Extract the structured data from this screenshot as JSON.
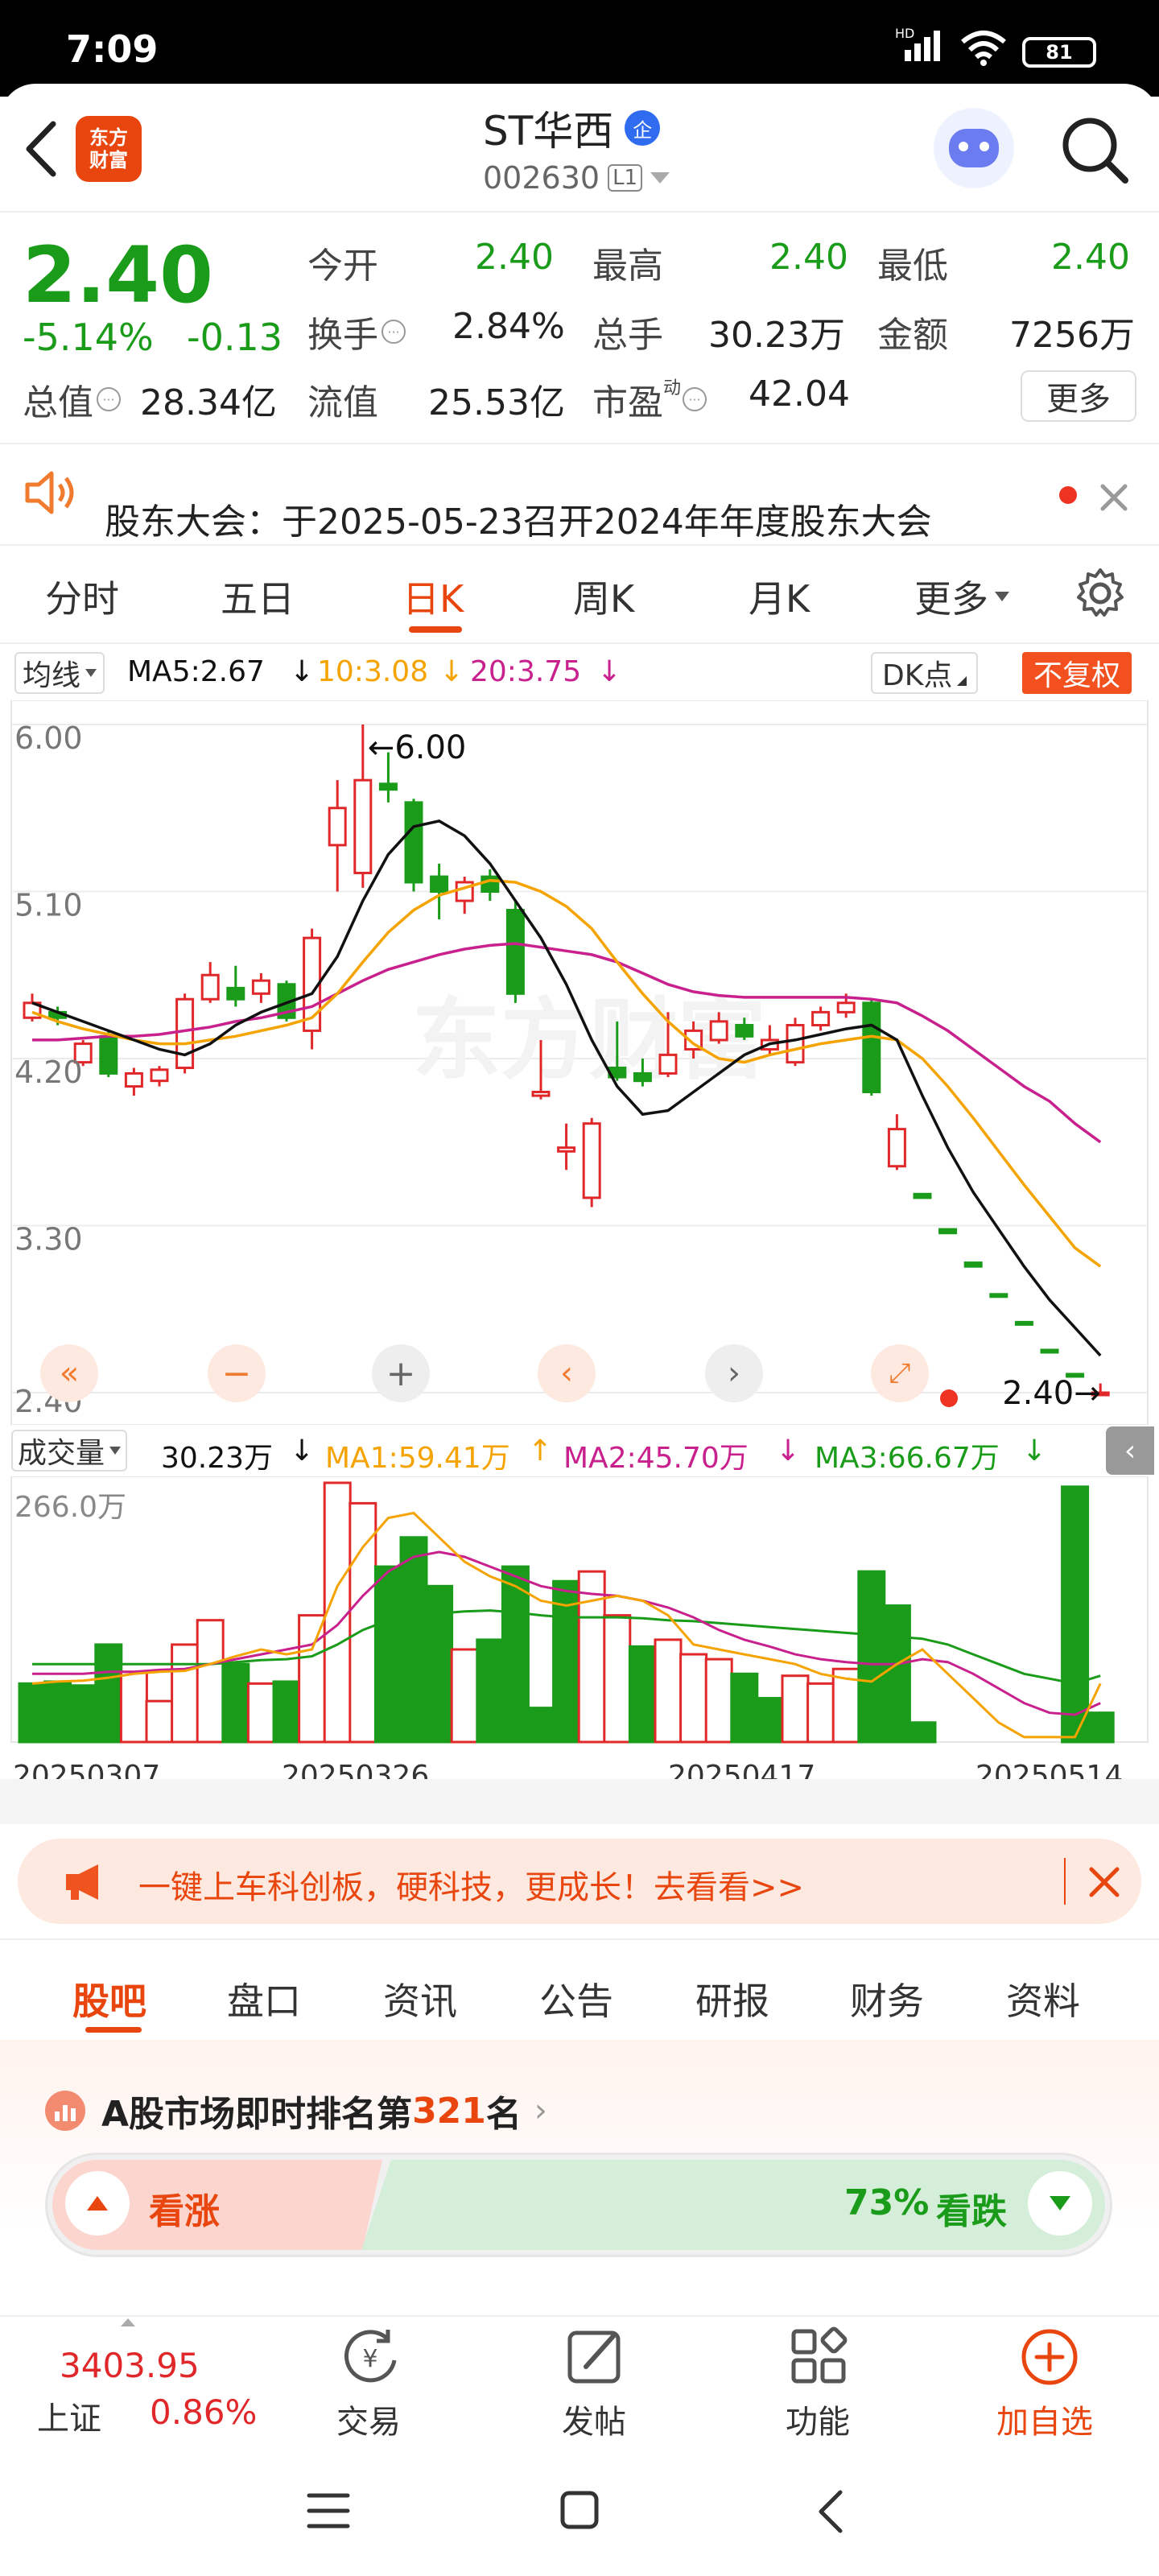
{
  "status_bar": {
    "time": "7:09",
    "net_tag": "HD",
    "battery": "81"
  },
  "header": {
    "app_logo_line1": "东方",
    "app_logo_line2": "财富",
    "stock_name": "ST华西",
    "badge": "企",
    "stock_code": "002630",
    "level_tag": "L1"
  },
  "quote": {
    "price": "2.40",
    "change_pct": "-5.14%",
    "change": "-0.13",
    "open_label": "今开",
    "open": "2.40",
    "high_label": "最高",
    "high": "2.40",
    "low_label": "最低",
    "low": "2.40",
    "turnover_label": "换手",
    "turnover": "2.84%",
    "volume_label": "总手",
    "volume": "30.23万",
    "amount_label": "金额",
    "amount": "7256万",
    "mktcap_label": "总值",
    "mktcap": "28.34亿",
    "float_label": "流值",
    "float": "25.53亿",
    "pe_label": "市盈",
    "pe_sup": "动",
    "pe": "42.04",
    "more_label": "更多"
  },
  "notice": {
    "text": "股东大会：于2025-05-23召开2024年年度股东大会"
  },
  "chart_tabs": [
    "分时",
    "五日",
    "日K",
    "周K",
    "月K",
    "更多"
  ],
  "kline_bar": {
    "ma_type": "均线",
    "ma5": "MA5:2.67",
    "ma10": "10:3.08",
    "ma20": "20:3.75",
    "dk_label": "DK点",
    "adjust_label": "不复权"
  },
  "kline_axis": {
    "labels": [
      "6.00",
      "5.10",
      "4.20",
      "3.30",
      "2.40"
    ],
    "max_note": "←6.00",
    "last_note": "2.40→"
  },
  "volume_bar": {
    "label": "成交量",
    "current": "30.23万",
    "ma1": "MA1:59.41万",
    "ma2": "MA2:45.70万",
    "ma3": "MA3:66.67万",
    "max_label": "266.0万"
  },
  "dates": [
    "20250307",
    "20250326",
    "20250417",
    "20250514"
  ],
  "colors": {
    "up": "#e0282a",
    "down": "#1a9c1a",
    "accent": "#ff6600",
    "ma5": "#111111",
    "ma10": "#f5a300",
    "ma20": "#c8208c"
  },
  "chart_data": {
    "type": "candlestick",
    "y_range": [
      2.4,
      6.0
    ],
    "candles": [
      {
        "o": 4.42,
        "c": 4.5,
        "h": 4.55,
        "l": 4.4
      },
      {
        "o": 4.45,
        "c": 4.42,
        "h": 4.48,
        "l": 4.38
      },
      {
        "o": 4.18,
        "c": 4.28,
        "h": 4.3,
        "l": 4.16
      },
      {
        "o": 4.32,
        "c": 4.12,
        "h": 4.35,
        "l": 4.1
      },
      {
        "o": 4.05,
        "c": 4.12,
        "h": 4.15,
        "l": 4.0
      },
      {
        "o": 4.08,
        "c": 4.14,
        "h": 4.16,
        "l": 4.05
      },
      {
        "o": 4.15,
        "c": 4.52,
        "h": 4.55,
        "l": 4.12
      },
      {
        "o": 4.52,
        "c": 4.65,
        "h": 4.72,
        "l": 4.5
      },
      {
        "o": 4.58,
        "c": 4.52,
        "h": 4.7,
        "l": 4.48
      },
      {
        "o": 4.55,
        "c": 4.62,
        "h": 4.66,
        "l": 4.5
      },
      {
        "o": 4.6,
        "c": 4.42,
        "h": 4.62,
        "l": 4.4
      },
      {
        "o": 4.35,
        "c": 4.85,
        "h": 4.9,
        "l": 4.25
      },
      {
        "o": 5.35,
        "c": 5.55,
        "h": 5.7,
        "l": 5.1
      },
      {
        "o": 5.2,
        "c": 5.7,
        "h": 6.0,
        "l": 5.12
      },
      {
        "o": 5.68,
        "c": 5.65,
        "h": 5.85,
        "l": 5.58
      },
      {
        "o": 5.58,
        "c": 5.15,
        "h": 5.6,
        "l": 5.1
      },
      {
        "o": 5.18,
        "c": 5.1,
        "h": 5.25,
        "l": 4.95
      },
      {
        "o": 5.05,
        "c": 5.15,
        "h": 5.18,
        "l": 4.98
      },
      {
        "o": 5.18,
        "c": 5.1,
        "h": 5.22,
        "l": 5.05
      },
      {
        "o": 5.0,
        "c": 4.55,
        "h": 5.05,
        "l": 4.5
      },
      {
        "o": 4.0,
        "c": 4.02,
        "h": 4.3,
        "l": 3.98
      },
      {
        "o": 3.7,
        "c": 3.72,
        "h": 3.85,
        "l": 3.6
      },
      {
        "o": 3.45,
        "c": 3.85,
        "h": 3.88,
        "l": 3.4
      },
      {
        "o": 4.15,
        "c": 4.1,
        "h": 4.4,
        "l": 4.08
      },
      {
        "o": 4.12,
        "c": 4.08,
        "h": 4.2,
        "l": 4.05
      },
      {
        "o": 4.12,
        "c": 4.22,
        "h": 4.45,
        "l": 4.1
      },
      {
        "o": 4.25,
        "c": 4.35,
        "h": 4.4,
        "l": 4.2
      },
      {
        "o": 4.3,
        "c": 4.4,
        "h": 4.45,
        "l": 4.28
      },
      {
        "o": 4.38,
        "c": 4.32,
        "h": 4.42,
        "l": 4.3
      },
      {
        "o": 4.25,
        "c": 4.3,
        "h": 4.38,
        "l": 4.22
      },
      {
        "o": 4.18,
        "c": 4.38,
        "h": 4.42,
        "l": 4.16
      },
      {
        "o": 4.38,
        "c": 4.45,
        "h": 4.48,
        "l": 4.35
      },
      {
        "o": 4.45,
        "c": 4.5,
        "h": 4.55,
        "l": 4.42
      },
      {
        "o": 4.5,
        "c": 4.02,
        "h": 4.52,
        "l": 4.0
      },
      {
        "o": 3.62,
        "c": 3.82,
        "h": 3.9,
        "l": 3.6
      },
      {
        "o": 3.47,
        "c": 3.45,
        "h": 3.47,
        "l": 3.45
      },
      {
        "o": 3.28,
        "c": 3.26,
        "h": 3.28,
        "l": 3.26
      },
      {
        "o": 3.1,
        "c": 3.08,
        "h": 3.1,
        "l": 3.08
      },
      {
        "o": 2.93,
        "c": 2.92,
        "h": 2.93,
        "l": 2.92
      },
      {
        "o": 2.78,
        "c": 2.77,
        "h": 2.78,
        "l": 2.77
      },
      {
        "o": 2.63,
        "c": 2.62,
        "h": 2.63,
        "l": 2.62
      },
      {
        "o": 2.5,
        "c": 2.49,
        "h": 2.5,
        "l": 2.49
      },
      {
        "o": 2.4,
        "c": 2.4,
        "h": 2.45,
        "l": 2.4
      }
    ],
    "ma5": [
      4.5,
      4.45,
      4.4,
      4.35,
      4.3,
      4.25,
      4.22,
      4.28,
      4.38,
      4.45,
      4.5,
      4.55,
      4.75,
      5.05,
      5.3,
      5.45,
      5.48,
      5.4,
      5.25,
      5.05,
      4.85,
      4.6,
      4.3,
      4.05,
      3.9,
      3.92,
      4.02,
      4.12,
      4.22,
      4.28,
      4.3,
      4.33,
      4.36,
      4.38,
      4.3,
      4.0,
      3.72,
      3.48,
      3.28,
      3.08,
      2.9,
      2.75,
      2.6
    ],
    "ma10": [
      4.45,
      4.4,
      4.36,
      4.33,
      4.3,
      4.28,
      4.28,
      4.3,
      4.32,
      4.35,
      4.38,
      4.42,
      4.55,
      4.72,
      4.88,
      5.0,
      5.08,
      5.12,
      5.16,
      5.15,
      5.1,
      5.02,
      4.9,
      4.72,
      4.55,
      4.4,
      4.28,
      4.2,
      4.18,
      4.22,
      4.25,
      4.28,
      4.3,
      4.32,
      4.3,
      4.2,
      4.05,
      3.88,
      3.7,
      3.52,
      3.35,
      3.18,
      3.08
    ],
    "ma20": [
      4.3,
      4.3,
      4.31,
      4.32,
      4.32,
      4.33,
      4.35,
      4.37,
      4.4,
      4.42,
      4.45,
      4.48,
      4.55,
      4.62,
      4.68,
      4.72,
      4.76,
      4.79,
      4.81,
      4.82,
      4.8,
      4.78,
      4.76,
      4.72,
      4.66,
      4.6,
      4.56,
      4.54,
      4.53,
      4.53,
      4.53,
      4.53,
      4.53,
      4.52,
      4.5,
      4.43,
      4.35,
      4.25,
      4.15,
      4.05,
      3.97,
      3.85,
      3.75
    ],
    "volume": [
      {
        "v": 60,
        "up": false
      },
      {
        "v": 62,
        "up": false
      },
      {
        "v": 58,
        "up": false
      },
      {
        "v": 100,
        "up": false
      },
      {
        "v": 72,
        "up": true
      },
      {
        "v": 42,
        "up": true
      },
      {
        "v": 100,
        "up": true
      },
      {
        "v": 125,
        "up": true
      },
      {
        "v": 80,
        "up": false
      },
      {
        "v": 60,
        "up": true
      },
      {
        "v": 62,
        "up": false
      },
      {
        "v": 130,
        "up": true
      },
      {
        "v": 266,
        "up": true
      },
      {
        "v": 245,
        "up": true
      },
      {
        "v": 180,
        "up": false
      },
      {
        "v": 210,
        "up": false
      },
      {
        "v": 160,
        "up": false
      },
      {
        "v": 95,
        "up": true
      },
      {
        "v": 105,
        "up": false
      },
      {
        "v": 180,
        "up": false
      },
      {
        "v": 35,
        "up": false
      },
      {
        "v": 165,
        "up": false
      },
      {
        "v": 175,
        "up": true
      },
      {
        "v": 130,
        "up": true
      },
      {
        "v": 98,
        "up": false
      },
      {
        "v": 105,
        "up": true
      },
      {
        "v": 90,
        "up": true
      },
      {
        "v": 85,
        "up": true
      },
      {
        "v": 70,
        "up": false
      },
      {
        "v": 45,
        "up": false
      },
      {
        "v": 68,
        "up": true
      },
      {
        "v": 60,
        "up": true
      },
      {
        "v": 75,
        "up": true
      },
      {
        "v": 175,
        "up": false
      },
      {
        "v": 140,
        "up": false
      },
      {
        "v": 20,
        "up": false
      },
      {
        "v": 0,
        "up": false
      },
      {
        "v": 0,
        "up": false
      },
      {
        "v": 0,
        "up": false
      },
      {
        "v": 0,
        "up": false
      },
      {
        "v": 0,
        "up": false
      },
      {
        "v": 262,
        "up": false
      },
      {
        "v": 30,
        "up": false
      }
    ],
    "vol_ma1": [
      60,
      62,
      63,
      66,
      70,
      72,
      73,
      80,
      88,
      95,
      90,
      95,
      160,
      200,
      230,
      235,
      210,
      185,
      170,
      160,
      145,
      140,
      145,
      150,
      145,
      130,
      100,
      95,
      90,
      85,
      80,
      70,
      65,
      62,
      80,
      95,
      70,
      45,
      20,
      5,
      5,
      5,
      60,
      55
    ],
    "vol_ma2": [
      70,
      70,
      70,
      72,
      72,
      74,
      75,
      80,
      85,
      90,
      95,
      100,
      120,
      150,
      175,
      190,
      195,
      190,
      180,
      170,
      160,
      155,
      152,
      150,
      145,
      138,
      128,
      115,
      105,
      98,
      90,
      85,
      82,
      80,
      80,
      85,
      82,
      70,
      55,
      40,
      30,
      28,
      40,
      45
    ],
    "vol_ma3": [
      80,
      80,
      80,
      80,
      80,
      80,
      80,
      80,
      82,
      84,
      85,
      88,
      100,
      115,
      125,
      130,
      132,
      134,
      135,
      133,
      130,
      128,
      128,
      128,
      127,
      125,
      124,
      122,
      120,
      118,
      116,
      114,
      112,
      110,
      108,
      106,
      100,
      90,
      80,
      70,
      65,
      60,
      68,
      70
    ]
  },
  "market_ad": {
    "text": "一键上车科创板，硬科技，更成长！去看看>>"
  },
  "content_tabs": [
    "股吧",
    "盘口",
    "资讯",
    "公告",
    "研报",
    "财务",
    "资料"
  ],
  "ranking": {
    "prefix": "A股市场即时排名第",
    "rank": "321",
    "suffix": "名"
  },
  "sentiment": {
    "up_label": "看涨",
    "down_pct": "73%",
    "down_label": "看跌"
  },
  "bottom_nav": {
    "index_value": "3403.95",
    "index_name": "上证",
    "index_change": "0.86%",
    "items": [
      "交易",
      "发帖",
      "功能",
      "加自选"
    ]
  }
}
